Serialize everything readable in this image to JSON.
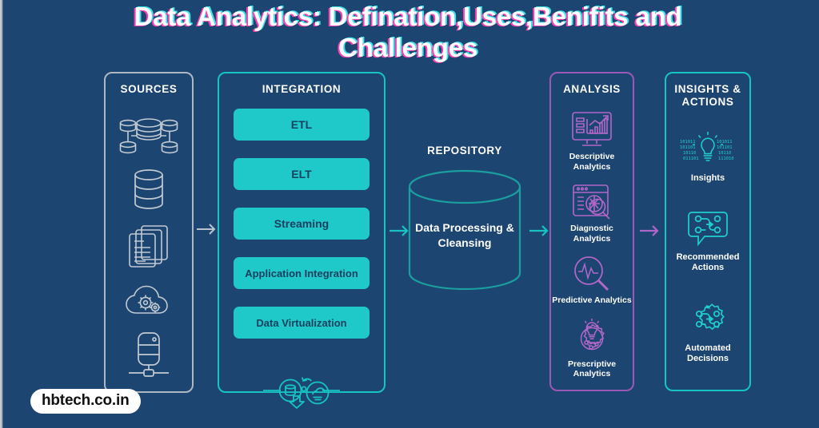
{
  "title": "Data Analytics: Defination,Uses,Benifits and Challenges",
  "colors": {
    "background": "#1d4571",
    "teal": "#17c4c4",
    "pill": "#20c9c9",
    "purple": "#9b59b6",
    "silver": "#aeb8c2",
    "title_shadow_pink": "#ff3fae",
    "title_shadow_cyan": "#3fe3ee",
    "text_white": "#ffffff",
    "pill_text": "#16405f"
  },
  "sources": {
    "heading": "SOURCES",
    "border_color": "#aeb8c2",
    "icons": [
      {
        "name": "distributed-databases-icon"
      },
      {
        "name": "database-icon"
      },
      {
        "name": "documents-icon"
      },
      {
        "name": "cloud-gears-icon"
      },
      {
        "name": "server-node-icon"
      }
    ]
  },
  "integration": {
    "heading": "INTEGRATION",
    "border_color": "#17c4c4",
    "items": [
      {
        "label": "ETL"
      },
      {
        "label": "ELT"
      },
      {
        "label": "Streaming"
      },
      {
        "label": "Application Integration"
      },
      {
        "label": "Data Virtualization"
      }
    ],
    "badge_icon": "data-migration-icon"
  },
  "repository": {
    "heading": "REPOSITORY",
    "label": "Data Processing & Cleansing",
    "shape": "cylinder",
    "border_color": "#17a2a2"
  },
  "analysis": {
    "heading": "ANALYSIS",
    "border_color": "#9b59b6",
    "items": [
      {
        "label": "Descriptive Analytics",
        "icon": "monitor-chart-icon"
      },
      {
        "label": "Diagnostic Analytics",
        "icon": "dashboard-magnifier-icon"
      },
      {
        "label": "Predictive Analytics",
        "icon": "pulse-magnifier-icon"
      },
      {
        "label": "Prescriptive Analytics",
        "icon": "gear-bulb-icon"
      }
    ]
  },
  "insights": {
    "heading": "INSIGHTS & ACTIONS",
    "heading_line1": "INSIGHTS &",
    "heading_line2": "ACTIONS",
    "border_color": "#17c4c4",
    "items": [
      {
        "label": "Insights",
        "icon": "bulb-binary-icon"
      },
      {
        "label": "Recommended Actions",
        "icon": "speech-flow-icon"
      },
      {
        "label": "Automated Decisions",
        "icon": "gear-flow-icon"
      }
    ]
  },
  "arrows": [
    {
      "name": "arrow-sources-to-integration",
      "color": "#b9c3cc"
    },
    {
      "name": "arrow-integration-to-repository",
      "color": "#17c4c4"
    },
    {
      "name": "arrow-repository-to-analysis",
      "color": "#17c4c4"
    },
    {
      "name": "arrow-analysis-to-insights",
      "color": "#b065c8"
    }
  ],
  "watermark": "hbtech.co.in"
}
